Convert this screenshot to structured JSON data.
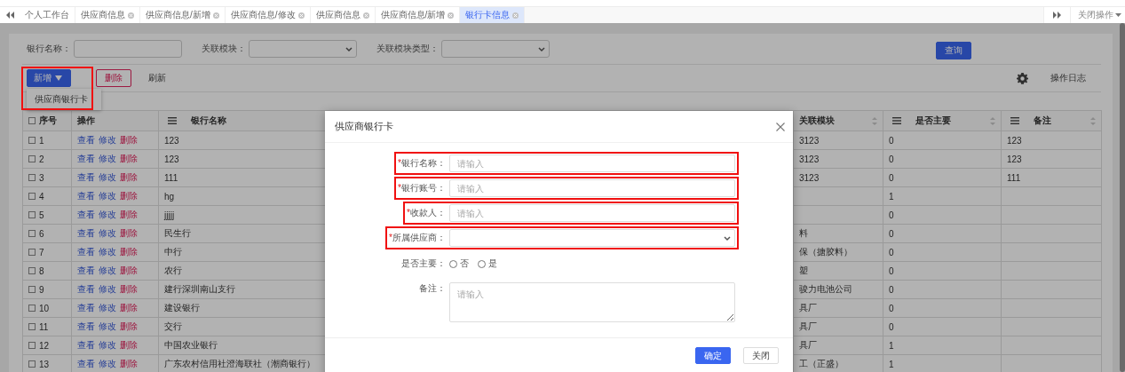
{
  "tabs": [
    {
      "label": "个人工作台",
      "closable": false,
      "selected": false
    },
    {
      "label": "供应商信息",
      "closable": true,
      "selected": false
    },
    {
      "label": "供应商信息/新增",
      "closable": true,
      "selected": false
    },
    {
      "label": "供应商信息/修改",
      "closable": true,
      "selected": false
    },
    {
      "label": "供应商信息",
      "closable": true,
      "selected": false
    },
    {
      "label": "供应商信息/新增",
      "closable": true,
      "selected": false
    },
    {
      "label": "银行卡信息",
      "closable": true,
      "selected": true
    }
  ],
  "close_menu": "关闭操作",
  "search": {
    "fields": [
      {
        "label": "银行名称：",
        "kind": "input"
      },
      {
        "label": "关联模块：",
        "kind": "select"
      },
      {
        "label": "关联模块类型：",
        "kind": "select"
      }
    ],
    "button": "查询"
  },
  "toolbar": {
    "add_button": "新增",
    "add_menu": {
      "expanded": true,
      "highlighted": true,
      "items": [
        "供应商银行卡"
      ]
    },
    "delete_button": "删除",
    "refresh_button": "刷新",
    "log_button": "操作日志"
  },
  "table": {
    "columns": [
      {
        "label": "序号",
        "kind": "check",
        "checked": false
      },
      {
        "label": "操作",
        "kind": "plain"
      },
      {
        "label": "银行名称",
        "kind": "menu"
      },
      {
        "kind": "hidden"
      },
      {
        "label": "关联模块",
        "kind": "sort"
      },
      {
        "label": "是否主要",
        "kind": "menu-sort"
      },
      {
        "label": "备注",
        "kind": "menu-sort"
      }
    ],
    "rows": [
      {
        "checked": false,
        "index": "1",
        "actions": [
          {
            "label": "查看",
            "kind": "view"
          },
          {
            "label": "修改",
            "kind": "edit"
          },
          {
            "label": "删除",
            "kind": "delete"
          }
        ],
        "bank": "123",
        "module": "3123",
        "primary": "0",
        "note": "123"
      },
      {
        "checked": false,
        "index": "2",
        "actions": [
          {
            "label": "查看",
            "kind": "view"
          },
          {
            "label": "修改",
            "kind": "edit"
          },
          {
            "label": "删除",
            "kind": "delete"
          }
        ],
        "bank": "123",
        "module": "3123",
        "primary": "0",
        "note": "123"
      },
      {
        "checked": false,
        "index": "3",
        "actions": [
          {
            "label": "查看",
            "kind": "view"
          },
          {
            "label": "修改",
            "kind": "edit"
          },
          {
            "label": "删除",
            "kind": "delete"
          }
        ],
        "bank": "111",
        "module": "3123",
        "primary": "0",
        "note": "111"
      },
      {
        "checked": false,
        "index": "4",
        "actions": [
          {
            "label": "查看",
            "kind": "view"
          },
          {
            "label": "修改",
            "kind": "edit"
          },
          {
            "label": "删除",
            "kind": "delete"
          }
        ],
        "bank": "hg",
        "primary": "1"
      },
      {
        "checked": false,
        "index": "5",
        "actions": [
          {
            "label": "查看",
            "kind": "view"
          },
          {
            "label": "修改",
            "kind": "edit"
          },
          {
            "label": "删除",
            "kind": "delete"
          }
        ],
        "bank": "jjjjj",
        "primary": "0"
      },
      {
        "checked": false,
        "index": "6",
        "actions": [
          {
            "label": "查看",
            "kind": "view"
          },
          {
            "label": "修改",
            "kind": "edit"
          },
          {
            "label": "删除",
            "kind": "delete"
          }
        ],
        "bank": "民生行",
        "module": "料",
        "primary": "0"
      },
      {
        "checked": false,
        "index": "7",
        "actions": [
          {
            "label": "查看",
            "kind": "view"
          },
          {
            "label": "修改",
            "kind": "edit"
          },
          {
            "label": "删除",
            "kind": "delete"
          }
        ],
        "bank": "中行",
        "module": "保（搪胶料）",
        "primary": "0"
      },
      {
        "checked": false,
        "index": "8",
        "actions": [
          {
            "label": "查看",
            "kind": "view"
          },
          {
            "label": "修改",
            "kind": "edit"
          },
          {
            "label": "删除",
            "kind": "delete"
          }
        ],
        "bank": "农行",
        "module": "塑",
        "primary": "0"
      },
      {
        "checked": false,
        "index": "9",
        "actions": [
          {
            "label": "查看",
            "kind": "view"
          },
          {
            "label": "修改",
            "kind": "edit"
          },
          {
            "label": "删除",
            "kind": "delete"
          }
        ],
        "bank": "建行深圳南山支行",
        "module": "骏力电池公司",
        "primary": "0"
      },
      {
        "checked": false,
        "index": "10",
        "actions": [
          {
            "label": "查看",
            "kind": "view"
          },
          {
            "label": "修改",
            "kind": "edit"
          },
          {
            "label": "删除",
            "kind": "delete"
          }
        ],
        "bank": "建设银行",
        "module": "具厂",
        "primary": "0"
      },
      {
        "checked": false,
        "index": "11",
        "actions": [
          {
            "label": "查看",
            "kind": "view"
          },
          {
            "label": "修改",
            "kind": "edit"
          },
          {
            "label": "删除",
            "kind": "delete"
          }
        ],
        "bank": "交行",
        "module": "具厂",
        "primary": "0"
      },
      {
        "checked": false,
        "index": "12",
        "actions": [
          {
            "label": "查看",
            "kind": "view"
          },
          {
            "label": "修改",
            "kind": "edit"
          },
          {
            "label": "删除",
            "kind": "delete"
          }
        ],
        "bank": "中国农业银行",
        "module": "具厂",
        "primary": "1"
      },
      {
        "checked": false,
        "index": "13",
        "actions": [
          {
            "label": "查看",
            "kind": "view"
          },
          {
            "label": "修改",
            "kind": "edit"
          },
          {
            "label": "删除",
            "kind": "delete"
          }
        ],
        "bank": "广东农村信用社澄海联社（潮商银行）",
        "module": "工（正盛）",
        "primary": "1"
      }
    ]
  },
  "modal": {
    "title": "供应商银行卡",
    "fields": [
      {
        "kind": "input",
        "required_mark": "*",
        "label": "银行名称：",
        "placeholder": "请输入",
        "highlighted": true
      },
      {
        "kind": "input",
        "required_mark": "*",
        "label": "银行账号：",
        "placeholder": "请输入",
        "highlighted": true
      },
      {
        "kind": "input",
        "required_mark": "*",
        "label": "收款人：",
        "placeholder": "请输入",
        "highlighted": true
      },
      {
        "kind": "select",
        "required_mark": "*",
        "label": "所属供应商：",
        "highlighted": true
      },
      {
        "kind": "radio",
        "label": "是否主要：",
        "options": [
          {
            "label": "否",
            "selected": false
          },
          {
            "label": "是",
            "selected": false
          }
        ]
      },
      {
        "kind": "textarea",
        "label": "备注：",
        "placeholder": "请输入"
      }
    ],
    "buttons": [
      {
        "label": "确定",
        "kind": "primary"
      },
      {
        "label": "关闭",
        "kind": "default"
      }
    ]
  }
}
